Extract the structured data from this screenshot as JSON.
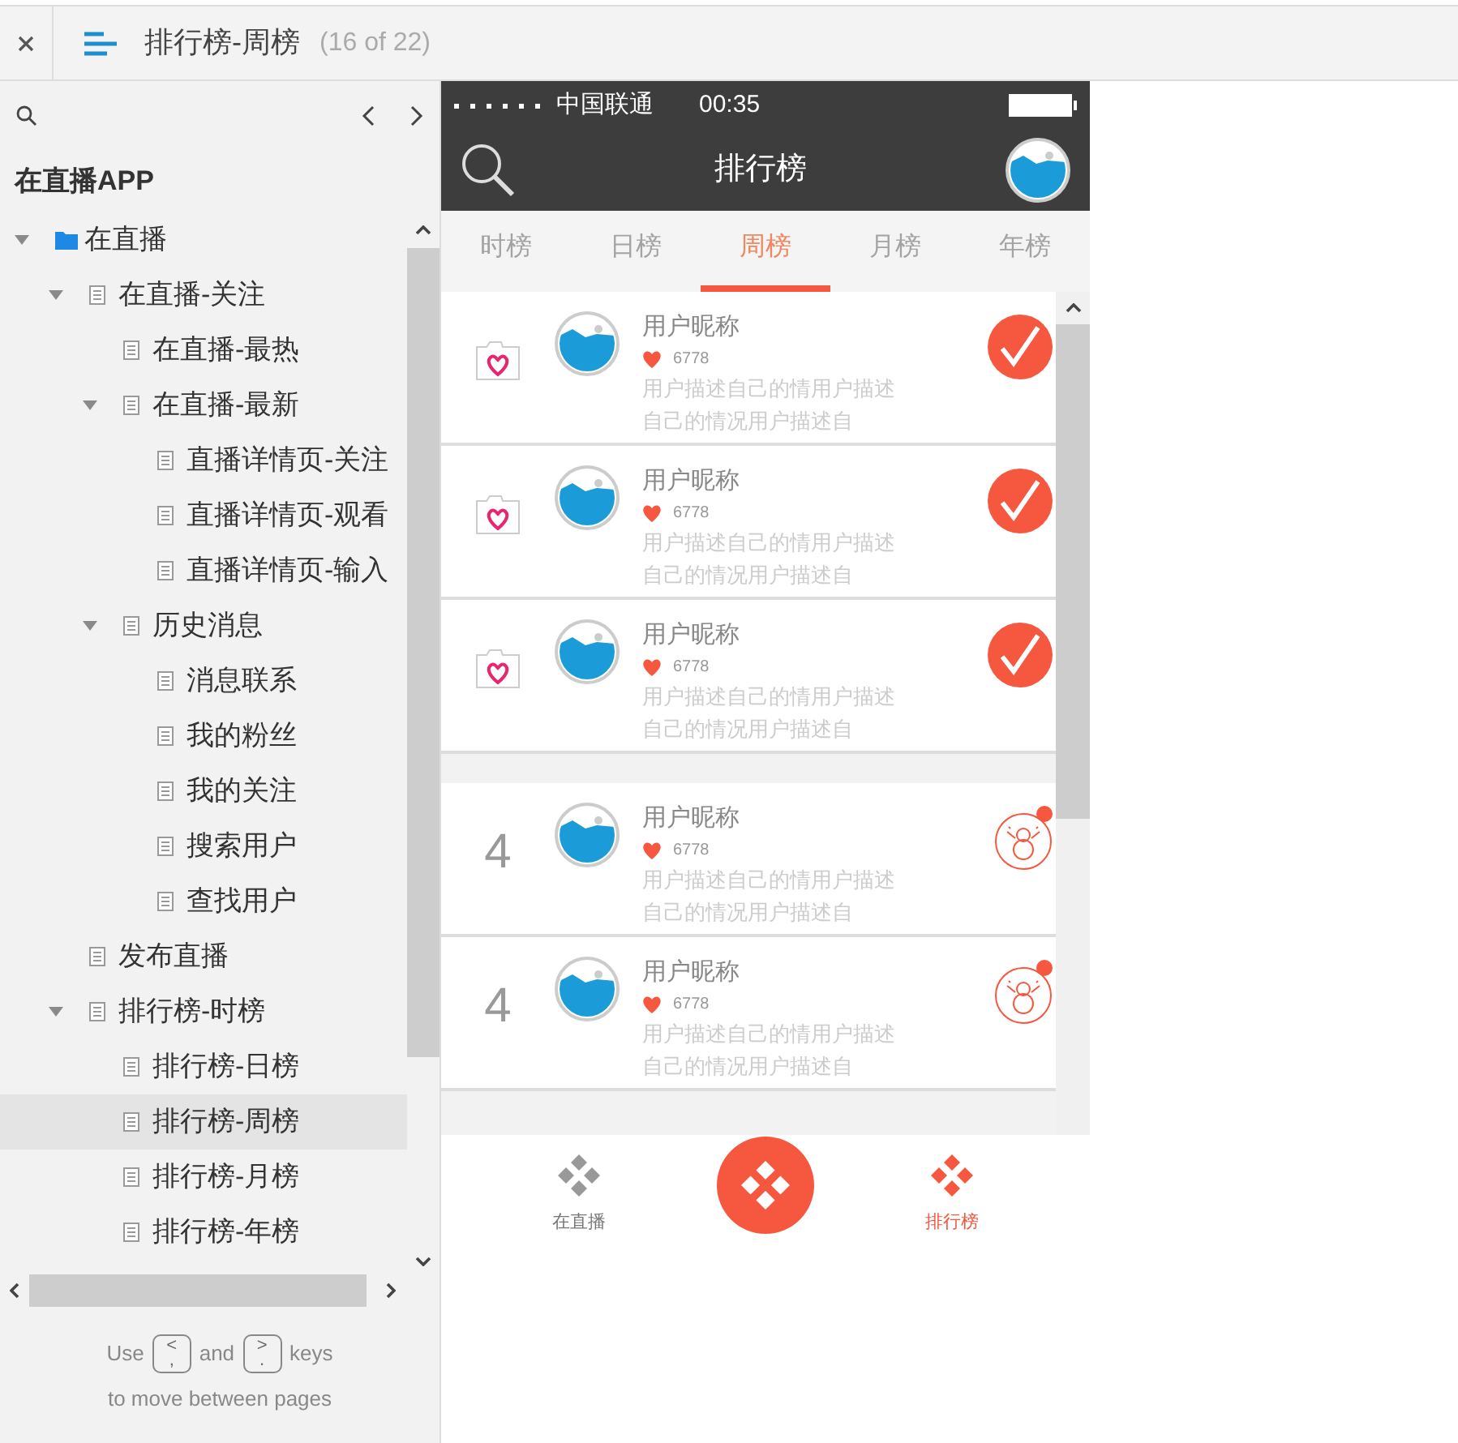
{
  "header": {
    "title": "排行榜-周榜",
    "page_count": "(16 of 22)"
  },
  "sidebar": {
    "project": "在直播APP",
    "tree": [
      {
        "label": "在直播",
        "kind": "folder",
        "expanded": true,
        "selected": false,
        "children": [
          {
            "label": "在直播-关注",
            "kind": "page",
            "expanded": true,
            "selected": false,
            "children": [
              {
                "label": "在直播-最热",
                "kind": "page",
                "selected": false
              },
              {
                "label": "在直播-最新",
                "kind": "page",
                "expanded": true,
                "selected": false,
                "children": [
                  {
                    "label": "直播详情页-关注",
                    "kind": "page",
                    "selected": false
                  },
                  {
                    "label": "直播详情页-观看",
                    "kind": "page",
                    "selected": false
                  },
                  {
                    "label": "直播详情页-输入",
                    "kind": "page",
                    "selected": false
                  }
                ]
              },
              {
                "label": "历史消息",
                "kind": "page",
                "expanded": true,
                "selected": false,
                "children": [
                  {
                    "label": "消息联系",
                    "kind": "page",
                    "selected": false
                  },
                  {
                    "label": "我的粉丝",
                    "kind": "page",
                    "selected": false
                  },
                  {
                    "label": "我的关注",
                    "kind": "page",
                    "selected": false
                  },
                  {
                    "label": "搜索用户",
                    "kind": "page",
                    "selected": false
                  },
                  {
                    "label": "查找用户",
                    "kind": "page",
                    "selected": false
                  }
                ]
              }
            ]
          },
          {
            "label": "发布直播",
            "kind": "page",
            "selected": false
          },
          {
            "label": "排行榜-时榜",
            "kind": "page",
            "expanded": true,
            "selected": false,
            "children": [
              {
                "label": "排行榜-日榜",
                "kind": "page",
                "selected": false
              },
              {
                "label": "排行榜-周榜",
                "kind": "page",
                "selected": true
              },
              {
                "label": "排行榜-月榜",
                "kind": "page",
                "selected": false
              },
              {
                "label": "排行榜-年榜",
                "kind": "page",
                "selected": false
              }
            ]
          }
        ]
      }
    ],
    "footer": {
      "use": "Use",
      "prev_key": {
        "top": "<",
        "bottom": ","
      },
      "and": "and",
      "next_key": {
        "top": ">",
        "bottom": "."
      },
      "keys": "keys",
      "hint": "to move between pages"
    }
  },
  "phone": {
    "status_bar": {
      "carrier": "中国联通",
      "time": "00:35"
    },
    "nav_title": "排行榜",
    "tabs": [
      {
        "label": "时榜",
        "selected": false
      },
      {
        "label": "日榜",
        "selected": false
      },
      {
        "label": "周榜",
        "selected": true
      },
      {
        "label": "月榜",
        "selected": false
      },
      {
        "label": "年榜",
        "selected": false
      }
    ],
    "rows": [
      {
        "kind": "top",
        "name": "用户昵称",
        "likes": "6778",
        "description": [
          "用户描述自己的情用户描述",
          "自己的情况用户描述自"
        ]
      },
      {
        "kind": "top",
        "name": "用户昵称",
        "likes": "6778",
        "description": [
          "用户描述自己的情用户描述",
          "自己的情况用户描述自"
        ]
      },
      {
        "kind": "top",
        "name": "用户昵称",
        "likes": "6778",
        "description": [
          "用户描述自己的情用户描述",
          "自己的情况用户描述自"
        ]
      },
      {
        "kind": "ranked",
        "rank": "4",
        "name": "用户昵称",
        "likes": "6778",
        "description": [
          "用户描述自己的情用户描述",
          "自己的情况用户描述自"
        ]
      },
      {
        "kind": "ranked",
        "rank": "4",
        "name": "用户昵称",
        "likes": "6778",
        "description": [
          "用户描述自己的情用户描述",
          "自己的情况用户描述自"
        ]
      }
    ],
    "bottom_nav": [
      {
        "label": "在直播",
        "selected": false
      },
      {
        "label": "排行榜",
        "selected": true
      }
    ]
  }
}
